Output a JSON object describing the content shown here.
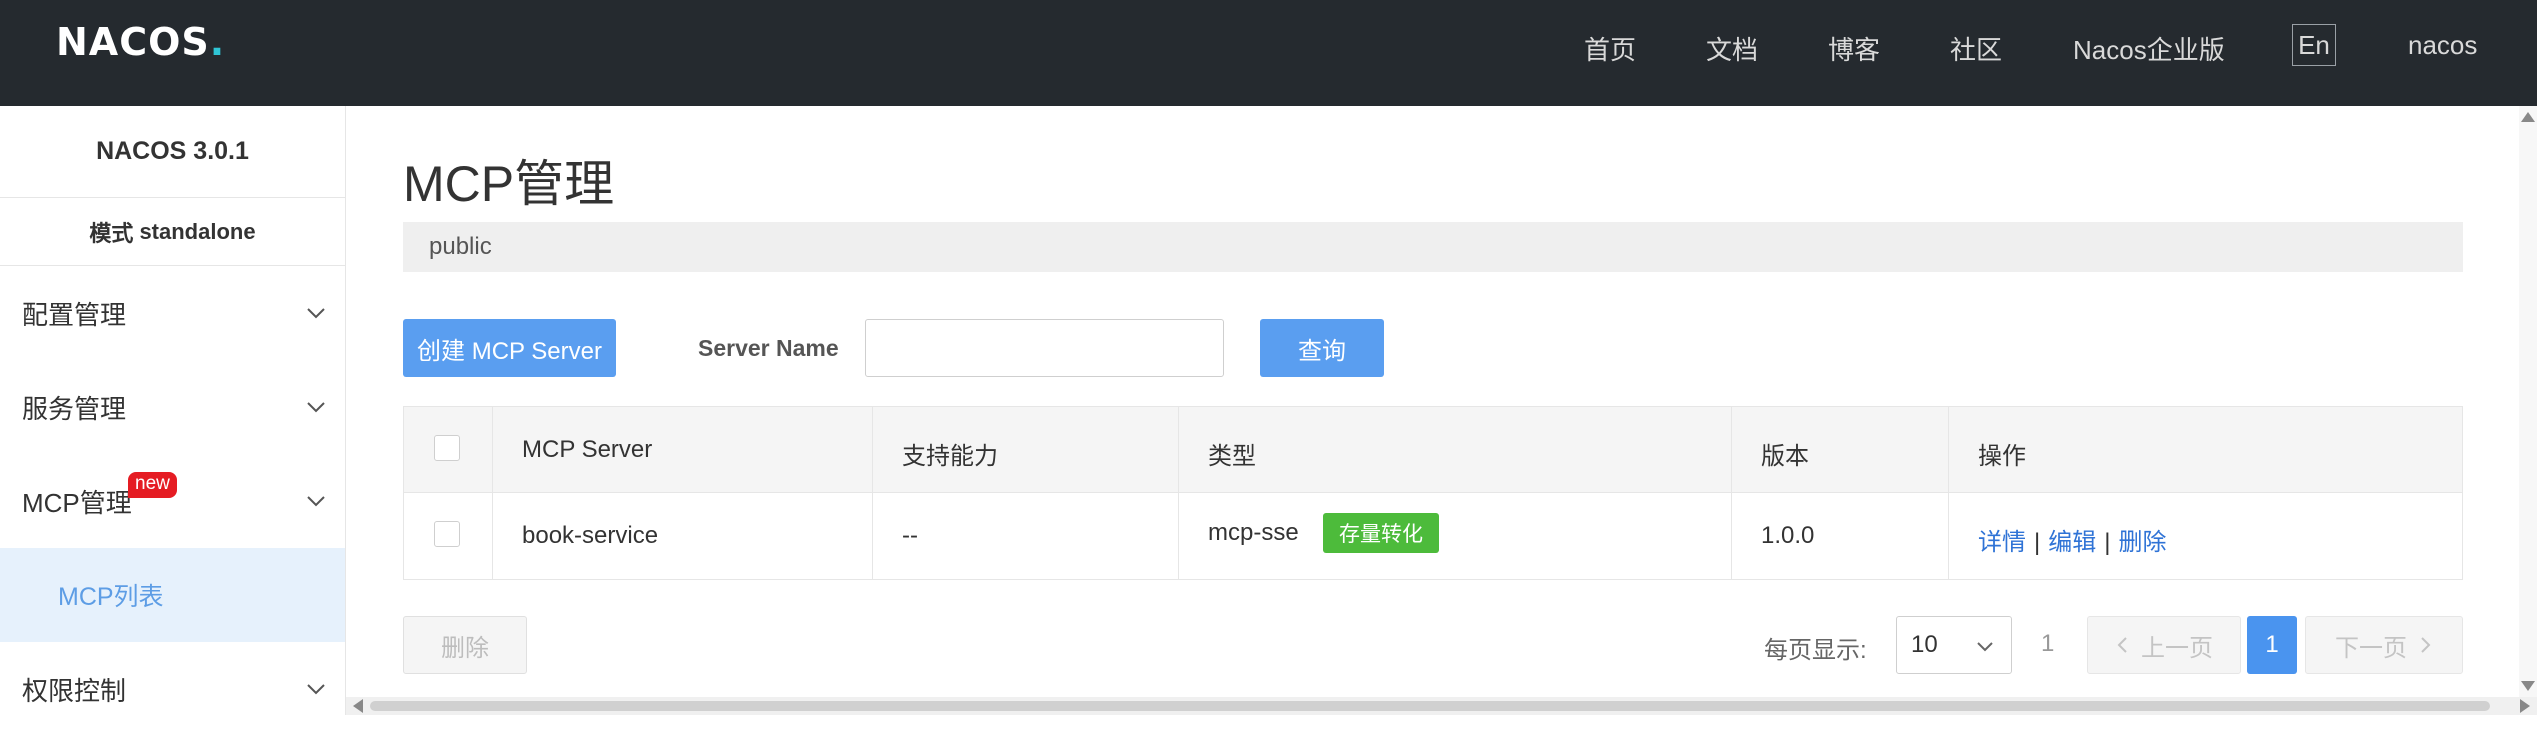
{
  "header": {
    "logo_text": "NACOS.",
    "nav": [
      "首页",
      "文档",
      "博客",
      "社区",
      "Nacos企业版"
    ],
    "lang": "En",
    "user": "nacos"
  },
  "sidebar": {
    "version": "NACOS 3.0.1",
    "mode_label": "模式",
    "mode_value": "standalone",
    "items": [
      {
        "label": "配置管理"
      },
      {
        "label": "服务管理"
      },
      {
        "label": "MCP管理",
        "badge": "new"
      },
      {
        "label": "权限控制"
      }
    ],
    "active_sub": "MCP列表"
  },
  "main": {
    "title": "MCP管理",
    "namespace": "public",
    "create_button": "创建 MCP Server",
    "search_label": "Server Name",
    "search_value": "",
    "query_button": "查询",
    "table": {
      "headers": [
        "MCP Server",
        "支持能力",
        "类型",
        "版本",
        "操作"
      ],
      "rows": [
        {
          "server": "book-service",
          "capability": "--",
          "type": "mcp-sse",
          "tag": "存量转化",
          "version": "1.0.0",
          "actions": [
            "详情",
            "编辑",
            "删除"
          ]
        }
      ]
    },
    "delete_button": "删除",
    "pagination": {
      "page_size_label": "每页显示:",
      "page_size": "10",
      "total": "1",
      "prev": "上一页",
      "current": "1",
      "next": "下一页"
    }
  },
  "colors": {
    "header_bg": "#252a2f",
    "primary": "#5a9ef0",
    "tag_green": "#4dbb3b",
    "badge_red": "#e51c23",
    "link": "#2f73d6"
  }
}
